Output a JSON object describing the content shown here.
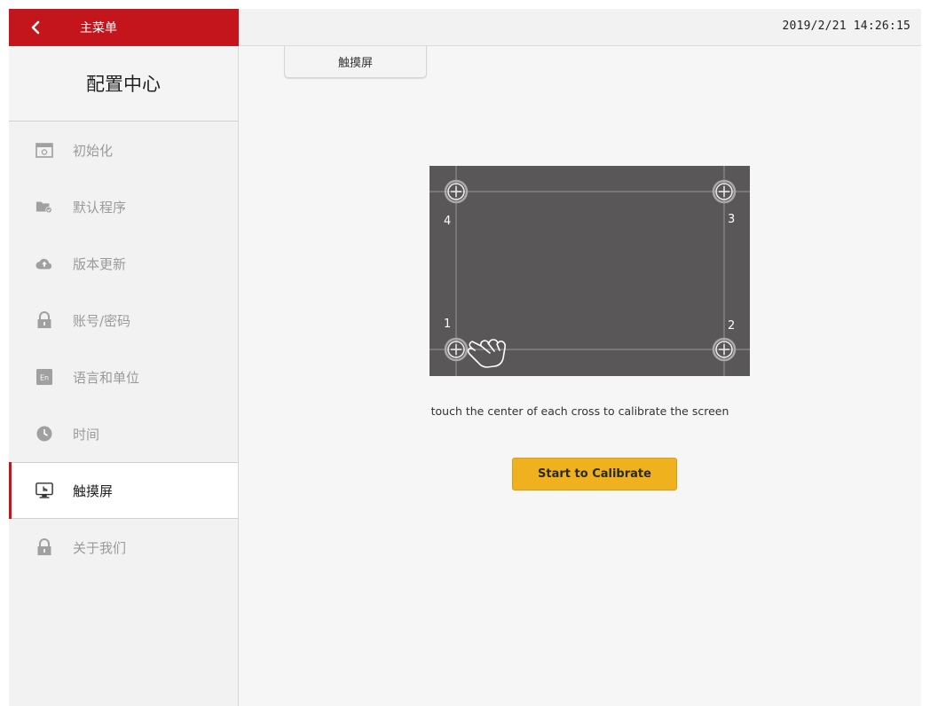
{
  "header": {
    "menu_title": "主菜单",
    "datetime": "2019/2/21 14:26:15"
  },
  "sidebar": {
    "title": "配置中心",
    "items": [
      {
        "label": "初始化",
        "icon": "calendar-icon",
        "active": false
      },
      {
        "label": "默认程序",
        "icon": "folder-check-icon",
        "active": false
      },
      {
        "label": "版本更新",
        "icon": "cloud-upload-icon",
        "active": false
      },
      {
        "label": "账号/密码",
        "icon": "lock-icon",
        "active": false
      },
      {
        "label": "语言和单位",
        "icon": "language-en-icon",
        "active": false
      },
      {
        "label": "时间",
        "icon": "clock-icon",
        "active": false
      },
      {
        "label": "触摸屏",
        "icon": "touchscreen-icon",
        "active": true
      },
      {
        "label": "关于我们",
        "icon": "lock-icon",
        "active": false
      }
    ]
  },
  "main": {
    "tab_label": "触摸屏",
    "calibration_points": [
      "1",
      "2",
      "3",
      "4"
    ],
    "instruction": "touch the center of each cross to calibrate the screen",
    "start_button": "Start to Calibrate"
  },
  "colors": {
    "brand_red": "#c4141c",
    "button_yellow": "#efb11e",
    "calib_bg": "#5a5758"
  }
}
